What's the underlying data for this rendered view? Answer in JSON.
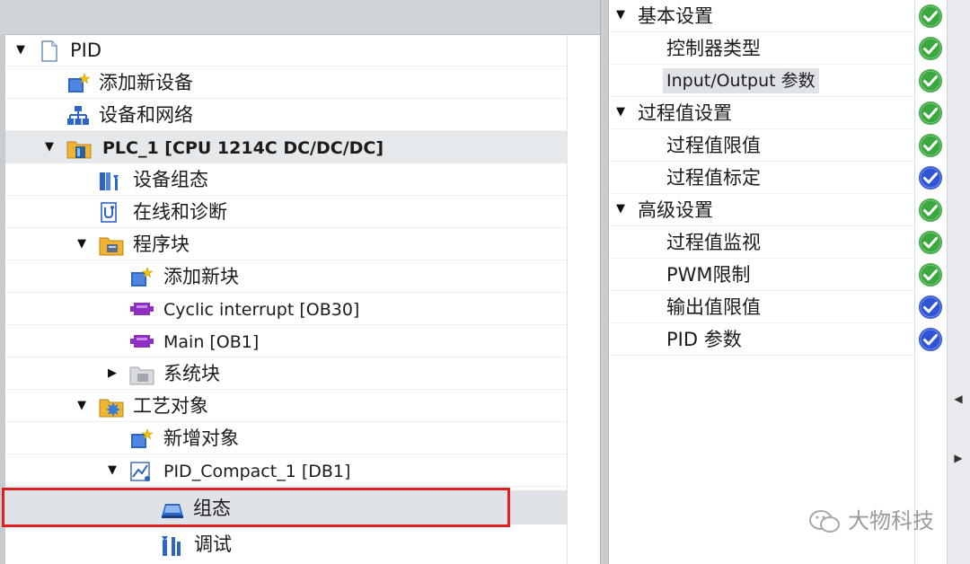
{
  "tree": {
    "root_label": "PID",
    "items": [
      {
        "label": "添加新设备",
        "icon": "add-device-icon"
      },
      {
        "label": "设备和网络",
        "icon": "network-icon"
      },
      {
        "label": "PLC_1 [CPU 1214C DC/DC/DC]",
        "icon": "plc-icon"
      },
      {
        "label": "设备组态",
        "icon": "device-config-icon"
      },
      {
        "label": "在线和诊断",
        "icon": "online-diagnostics-icon"
      },
      {
        "label": "程序块",
        "icon": "program-blocks-folder-icon"
      },
      {
        "label": "添加新块",
        "icon": "add-block-icon"
      },
      {
        "label": "Cyclic interrupt [OB30]",
        "icon": "ob-block-icon"
      },
      {
        "label": "Main [OB1]",
        "icon": "ob-block-icon"
      },
      {
        "label": "系统块",
        "icon": "system-blocks-folder-icon"
      },
      {
        "label": "工艺对象",
        "icon": "technology-objects-folder-icon"
      },
      {
        "label": "新增对象",
        "icon": "add-object-icon"
      },
      {
        "label": "PID_Compact_1 [DB1]",
        "icon": "pid-compact-icon"
      },
      {
        "label": "组态",
        "icon": "configuration-icon"
      },
      {
        "label": "调试",
        "icon": "commissioning-icon"
      }
    ]
  },
  "settings": {
    "items": [
      {
        "label": "基本设置",
        "status": "green"
      },
      {
        "label": "控制器类型",
        "status": "green"
      },
      {
        "label": "Input/Output 参数",
        "status": "green"
      },
      {
        "label": "过程值设置",
        "status": "green"
      },
      {
        "label": "过程值限值",
        "status": "green"
      },
      {
        "label": "过程值标定",
        "status": "blue"
      },
      {
        "label": "高级设置",
        "status": "green"
      },
      {
        "label": "过程值监视",
        "status": "green"
      },
      {
        "label": "PWM限制",
        "status": "green"
      },
      {
        "label": "输出值限值",
        "status": "blue"
      },
      {
        "label": "PID 参数",
        "status": "blue"
      }
    ]
  },
  "colors": {
    "status_green": "#3aa83f",
    "status_blue": "#2f55d4",
    "selection_border": "#e02020"
  },
  "watermark": {
    "text": "大物科技"
  }
}
